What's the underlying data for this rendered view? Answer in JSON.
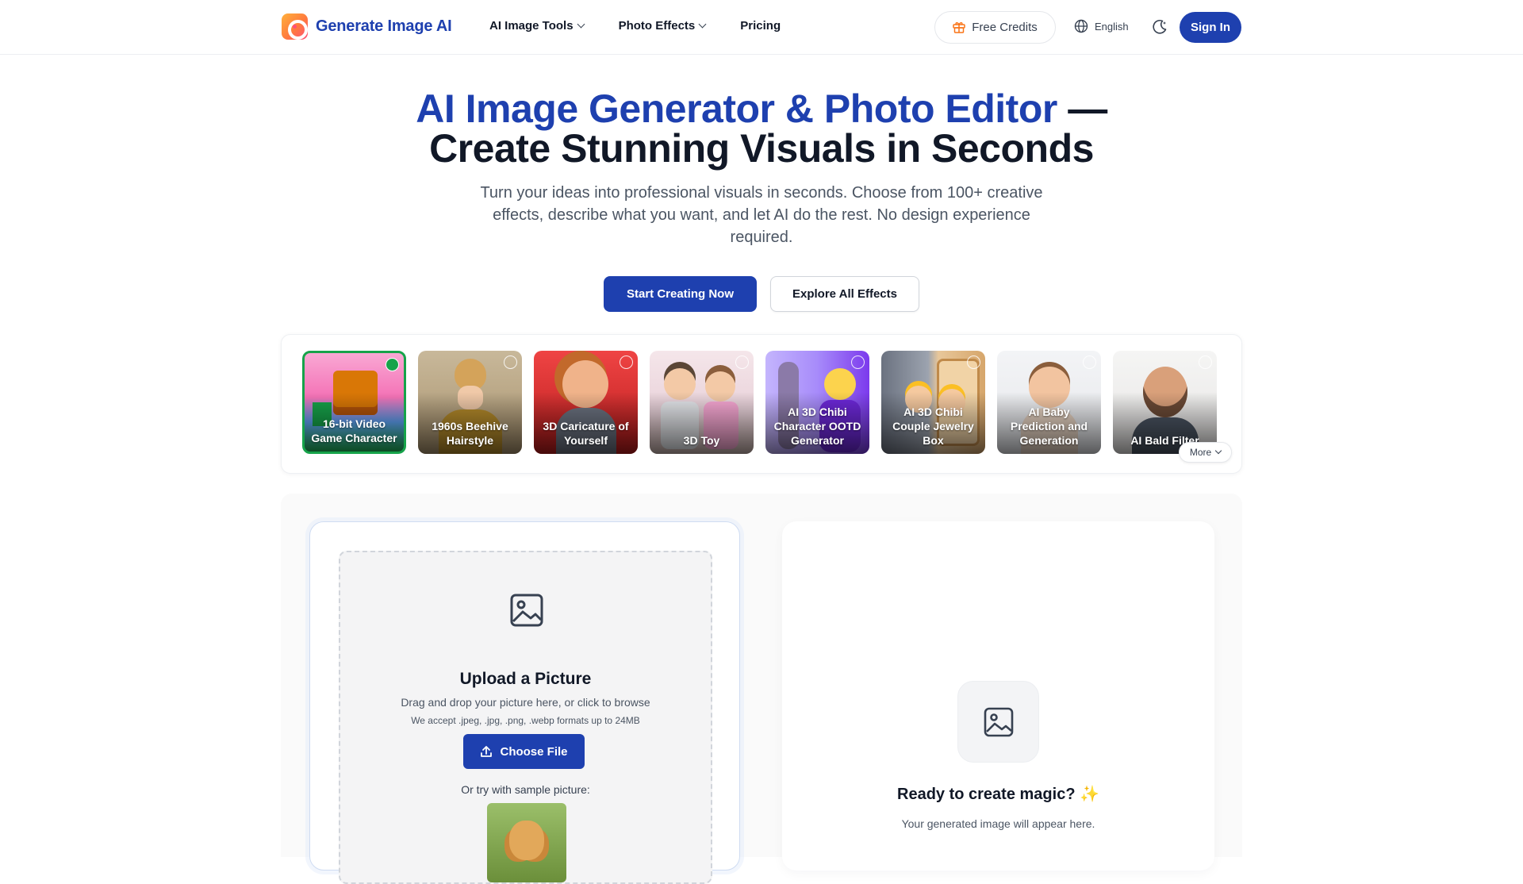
{
  "header": {
    "brand": "Generate Image AI",
    "nav": [
      {
        "label": "AI Image Tools",
        "has_dropdown": true
      },
      {
        "label": "Photo Effects",
        "has_dropdown": true
      },
      {
        "label": "Pricing",
        "has_dropdown": false
      }
    ],
    "free_credits": "Free Credits",
    "language": "English",
    "sign_in": "Sign In",
    "icons": {
      "credits": "gift-icon",
      "language": "globe-icon",
      "theme": "moon-icon"
    }
  },
  "hero": {
    "title_accent": "AI Image Generator & Photo Editor",
    "title_dash": " —",
    "title_line2": "Create Stunning Visuals in Seconds",
    "subtitle": "Turn your ideas into professional visuals in seconds. Choose from 100+ creative effects, describe what you want, and let AI do the rest. No design experience required.",
    "primary_cta": "Start Creating Now",
    "secondary_cta": "Explore All Effects"
  },
  "effects": {
    "items": [
      {
        "label": "16-bit Video Game Character",
        "selected": true
      },
      {
        "label": "1960s Beehive Hairstyle",
        "selected": false
      },
      {
        "label": "3D Caricature of Yourself",
        "selected": false
      },
      {
        "label": "3D Toy",
        "selected": false
      },
      {
        "label": "AI 3D Chibi Character OOTD Generator",
        "selected": false
      },
      {
        "label": "AI 3D Chibi Couple Jewelry Box",
        "selected": false
      },
      {
        "label": "AI Baby Prediction and Generation",
        "selected": false
      },
      {
        "label": "AI Bald Filter",
        "selected": false
      }
    ],
    "more_label": "More"
  },
  "upload": {
    "title": "Upload a Picture",
    "help": "Drag and drop your picture here, or click to browse",
    "formats": "We accept .jpeg, .jpg, .png, .webp formats up to 24MB",
    "choose_file": "Choose File",
    "sample_label": "Or try with sample picture:"
  },
  "result": {
    "title": "Ready to create magic? ✨",
    "subtitle": "Your generated image will appear here."
  },
  "colors": {
    "brand": "#1e40af",
    "selected": "#16a34a"
  }
}
